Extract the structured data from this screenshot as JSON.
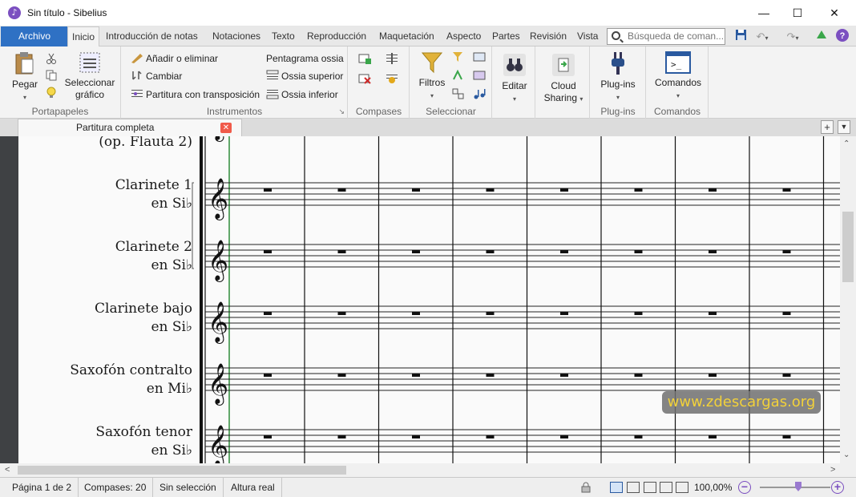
{
  "window": {
    "title": "Sin título - Sibelius",
    "app_icon": "sibelius-logo",
    "controls": [
      "minimize",
      "maximize",
      "close"
    ]
  },
  "ribbon_tabs": [
    {
      "label": "Archivo",
      "kind": "file"
    },
    {
      "label": "Inicio",
      "active": true
    },
    {
      "label": "Introducción de notas"
    },
    {
      "label": "Notaciones"
    },
    {
      "label": "Texto"
    },
    {
      "label": "Reproducción"
    },
    {
      "label": "Maquetación"
    },
    {
      "label": "Aspecto"
    },
    {
      "label": "Partes"
    },
    {
      "label": "Revisión"
    },
    {
      "label": "Vista"
    }
  ],
  "search": {
    "placeholder": "Búsqueda de coman..."
  },
  "ribbon": {
    "portapapeles": {
      "label": "Portapapeles",
      "paste": "Pegar",
      "select_graphic": "Seleccionar\ngráfico",
      "select_graphic_lines": [
        "Seleccionar",
        "gráfico"
      ]
    },
    "instrumentos": {
      "label": "Instrumentos",
      "add_remove": "Añadir o eliminar",
      "change": "Cambiar",
      "transposing": "Partitura con transposición",
      "ossia_staff": "Pentagrama ossia",
      "ossia_above": "Ossia superior",
      "ossia_below": "Ossia inferior"
    },
    "compases": {
      "label": "Compases"
    },
    "seleccionar": {
      "label": "Seleccionar",
      "filters": "Filtros"
    },
    "editar": {
      "label": "Editar"
    },
    "cloud": {
      "line1": "Cloud",
      "line2": "Sharing"
    },
    "plugins": {
      "button": "Plug-ins",
      "label": "Plug-ins"
    },
    "comandos": {
      "button": "Comandos",
      "label": "Comandos"
    }
  },
  "document_tab": {
    "label": "Partitura completa"
  },
  "score": {
    "instruments": [
      {
        "line1": "(op. Flauta 2)",
        "line2": ""
      },
      {
        "line1": "Clarinete 1",
        "line2": "en Si♭"
      },
      {
        "line1": "Clarinete 2",
        "line2": "en Si♭"
      },
      {
        "line1": "Clarinete bajo",
        "line2": "en Si♭"
      },
      {
        "line1": "Saxofón contralto",
        "line2": "en Mi♭"
      },
      {
        "line1": "Saxofón tenor",
        "line2": "en Si♭"
      }
    ],
    "measures_visible": 8,
    "clef": "treble",
    "rest": "whole-bar-rest"
  },
  "watermark": "www.zdescargas.org",
  "status": {
    "page": "Página 1 de 2",
    "bars": "Compases: 20",
    "selection": "Sin selección",
    "pitch": "Altura real",
    "zoom": "100,00%",
    "zoom_level": 0.55
  },
  "colors": {
    "file_tab": "#2f71c4",
    "accent_purple": "#7b4fc0",
    "close_red": "#f05a4a",
    "watermark_text": "#f2d13a"
  }
}
